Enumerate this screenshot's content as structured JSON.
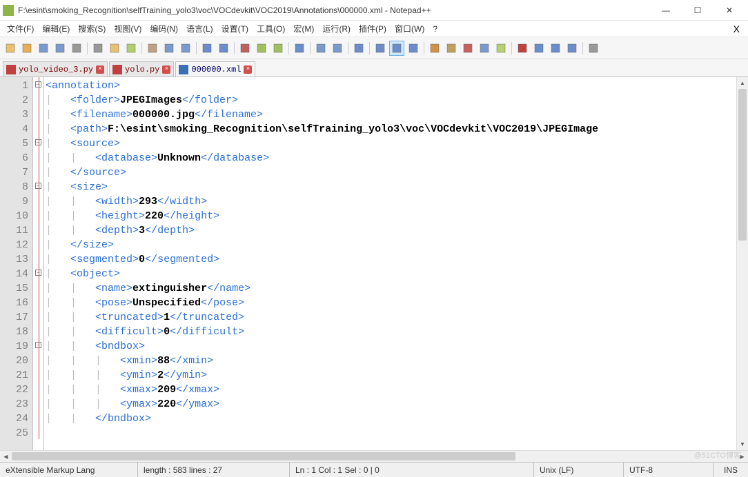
{
  "window": {
    "title": "F:\\esint\\smoking_Recognition\\selfTraining_yolo3\\voc\\VOCdevkit\\VOC2019\\Annotations\\000000.xml - Notepad++",
    "min": "—",
    "max": "☐",
    "close": "✕"
  },
  "menu": {
    "items": [
      "文件(F)",
      "编辑(E)",
      "搜索(S)",
      "视图(V)",
      "编码(N)",
      "语言(L)",
      "设置(T)",
      "工具(O)",
      "宏(M)",
      "运行(R)",
      "插件(P)",
      "窗口(W)",
      "?"
    ],
    "x": "X"
  },
  "tabs": [
    {
      "label": "yolo_video_3.py",
      "saved": false,
      "active": false
    },
    {
      "label": "yolo.py",
      "saved": false,
      "active": false
    },
    {
      "label": "000000.xml",
      "saved": true,
      "active": true
    }
  ],
  "code": {
    "lines": [
      {
        "indent": 0,
        "open": "<annotation>",
        "text": "",
        "close": ""
      },
      {
        "indent": 1,
        "open": "<folder>",
        "text": "JPEGImages",
        "close": "</folder>"
      },
      {
        "indent": 1,
        "open": "<filename>",
        "text": "000000.jpg",
        "close": "</filename>"
      },
      {
        "indent": 1,
        "open": "<path>",
        "text": "F:\\esint\\smoking_Recognition\\selfTraining_yolo3\\voc\\VOCdevkit\\VOC2019\\JPEGImage",
        "close": ""
      },
      {
        "indent": 1,
        "open": "<source>",
        "text": "",
        "close": ""
      },
      {
        "indent": 2,
        "open": "<database>",
        "text": "Unknown",
        "close": "</database>"
      },
      {
        "indent": 1,
        "open": "</source>",
        "text": "",
        "close": ""
      },
      {
        "indent": 1,
        "open": "<size>",
        "text": "",
        "close": ""
      },
      {
        "indent": 2,
        "open": "<width>",
        "text": "293",
        "close": "</width>"
      },
      {
        "indent": 2,
        "open": "<height>",
        "text": "220",
        "close": "</height>"
      },
      {
        "indent": 2,
        "open": "<depth>",
        "text": "3",
        "close": "</depth>"
      },
      {
        "indent": 1,
        "open": "</size>",
        "text": "",
        "close": ""
      },
      {
        "indent": 1,
        "open": "<segmented>",
        "text": "0",
        "close": "</segmented>"
      },
      {
        "indent": 1,
        "open": "<object>",
        "text": "",
        "close": ""
      },
      {
        "indent": 2,
        "open": "<name>",
        "text": "extinguisher",
        "close": "</name>"
      },
      {
        "indent": 2,
        "open": "<pose>",
        "text": "Unspecified",
        "close": "</pose>"
      },
      {
        "indent": 2,
        "open": "<truncated>",
        "text": "1",
        "close": "</truncated>"
      },
      {
        "indent": 2,
        "open": "<difficult>",
        "text": "0",
        "close": "</difficult>"
      },
      {
        "indent": 2,
        "open": "<bndbox>",
        "text": "",
        "close": ""
      },
      {
        "indent": 3,
        "open": "<xmin>",
        "text": "88",
        "close": "</xmin>"
      },
      {
        "indent": 3,
        "open": "<ymin>",
        "text": "2",
        "close": "</ymin>"
      },
      {
        "indent": 3,
        "open": "<xmax>",
        "text": "209",
        "close": "</xmax>"
      },
      {
        "indent": 3,
        "open": "<ymax>",
        "text": "220",
        "close": "</ymax>"
      },
      {
        "indent": 2,
        "open": "</bndbox>",
        "text": "",
        "close": ""
      }
    ],
    "fold": [
      "minus",
      "",
      "",
      "",
      "minus",
      "",
      "",
      "minus",
      "",
      "",
      "",
      "",
      "",
      "minus",
      "",
      "",
      "",
      "",
      "minus",
      "",
      "",
      "",
      "",
      ""
    ]
  },
  "status": {
    "lang": "eXtensible Markup Lang",
    "length": "length : 583    lines : 27",
    "pos": "Ln : 1    Col : 1    Sel : 0 | 0",
    "eol": "Unix (LF)",
    "enc": "UTF-8",
    "ins": "INS"
  },
  "watermark": "@51CTO博客"
}
